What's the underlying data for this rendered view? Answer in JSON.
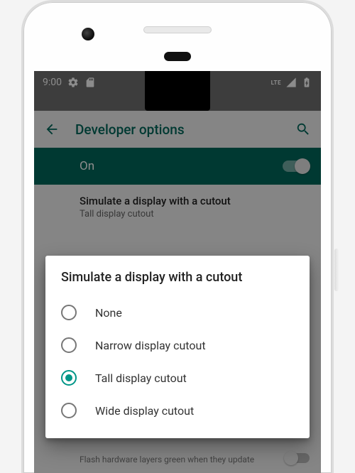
{
  "status": {
    "time": "9:00",
    "lte": "LTE"
  },
  "appbar": {
    "title": "Developer options"
  },
  "toggle": {
    "label": "On",
    "value": true
  },
  "setting": {
    "title": "Simulate a display with a cutout",
    "subtitle": "Tall display cutout"
  },
  "bg_row": {
    "text": "Flash hardware layers green when they update"
  },
  "dialog": {
    "title": "Simulate a display with a cutout",
    "options": [
      {
        "label": "None",
        "selected": false
      },
      {
        "label": "Narrow display cutout",
        "selected": false
      },
      {
        "label": "Tall display cutout",
        "selected": true
      },
      {
        "label": "Wide display cutout",
        "selected": false
      }
    ]
  },
  "colors": {
    "accent": "#009688",
    "appbar_accent": "#00695c"
  }
}
